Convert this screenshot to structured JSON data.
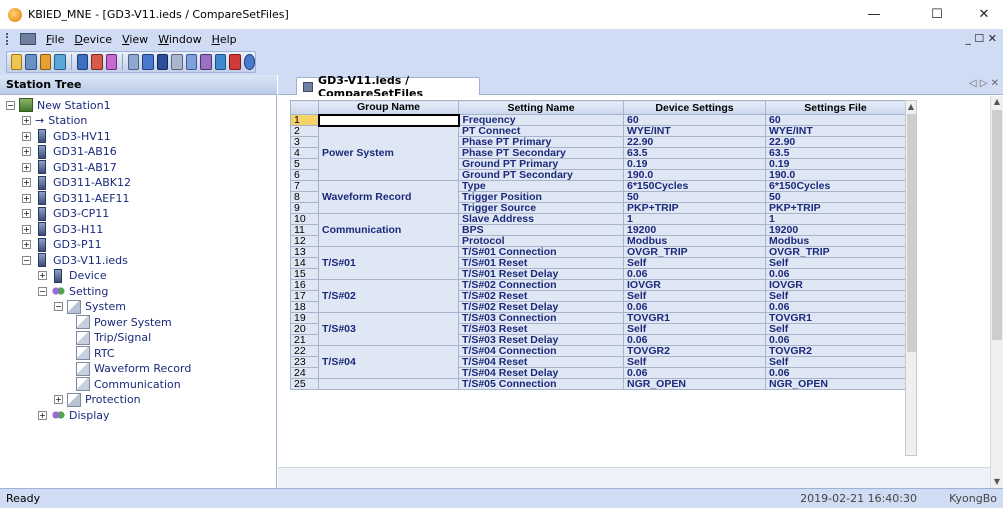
{
  "window": {
    "title": "KBIED_MNE - [GD3-V11.ieds / CompareSetFiles]",
    "minimize": "—",
    "maximize": "☐",
    "close": "✕",
    "mdi_controls": "_ ☐ ✕"
  },
  "menu": {
    "items": [
      "File",
      "Device",
      "View",
      "Window",
      "Help"
    ]
  },
  "toolbar": {
    "icons": [
      "new-icon",
      "open-icon",
      "save-icon",
      "print-icon",
      "compare-icon",
      "upload-icon",
      "download-icon",
      "link-icon",
      "monitor-icon",
      "grid-icon",
      "window-icon",
      "wave-icon",
      "wave2-icon",
      "export-icon",
      "close-icon",
      "help-icon"
    ]
  },
  "left_pane": {
    "title": "Station Tree",
    "tree": [
      {
        "label": "New Station1",
        "level": 0,
        "icon": "station-icon",
        "expander": "−"
      },
      {
        "label": "Station",
        "level": 1,
        "icon": "arrow",
        "expander": "+"
      },
      {
        "label": "GD3-HV11",
        "level": 1,
        "icon": "ied-icon",
        "expander": "+"
      },
      {
        "label": "GD31-AB16",
        "level": 1,
        "icon": "ied-icon",
        "expander": "+"
      },
      {
        "label": "GD31-AB17",
        "level": 1,
        "icon": "ied-icon",
        "expander": "+"
      },
      {
        "label": "GD311-ABK12",
        "level": 1,
        "icon": "ied-icon",
        "expander": "+"
      },
      {
        "label": "GD311-AEF11",
        "level": 1,
        "icon": "ied-icon",
        "expander": "+"
      },
      {
        "label": "GD3-CP11",
        "level": 1,
        "icon": "ied-icon",
        "expander": "+"
      },
      {
        "label": "GD3-H11",
        "level": 1,
        "icon": "ied-icon",
        "expander": "+"
      },
      {
        "label": "GD3-P11",
        "level": 1,
        "icon": "ied-icon",
        "expander": "+"
      },
      {
        "label": "GD3-V11.ieds",
        "level": 1,
        "icon": "ied-icon",
        "expander": "−"
      },
      {
        "label": "Device",
        "level": 2,
        "icon": "ied-icon",
        "expander": "+"
      },
      {
        "label": "Setting",
        "level": 2,
        "icon": "setting-icon",
        "expander": "−"
      },
      {
        "label": "System",
        "level": 3,
        "icon": "folder-icon",
        "expander": "−"
      },
      {
        "label": "Power System",
        "level": 4,
        "icon": "leaf-icon",
        "expander": ""
      },
      {
        "label": "Trip/Signal",
        "level": 4,
        "icon": "leaf-icon",
        "expander": ""
      },
      {
        "label": "RTC",
        "level": 4,
        "icon": "leaf-icon",
        "expander": ""
      },
      {
        "label": "Waveform Record",
        "level": 4,
        "icon": "leaf-icon",
        "expander": ""
      },
      {
        "label": "Communication",
        "level": 4,
        "icon": "leaf-icon",
        "expander": ""
      },
      {
        "label": "Protection",
        "level": 3,
        "icon": "folder-icon",
        "expander": "+"
      },
      {
        "label": "Display",
        "level": 2,
        "icon": "setting-icon",
        "expander": "+"
      }
    ]
  },
  "right_pane": {
    "tab": "GD3-V11.ieds / CompareSetFiles",
    "tab_nav": "◁ ▷ ✕"
  },
  "table": {
    "headers": {
      "group": "Group Name",
      "setting": "Setting Name",
      "device": "Device Settings",
      "file": "Settings File"
    },
    "groups": [
      {
        "name": "",
        "rows": [
          1
        ]
      },
      {
        "name": "Power System",
        "rows": [
          2,
          3,
          4,
          5,
          6
        ]
      },
      {
        "name": "Waveform Record",
        "rows": [
          7,
          8,
          9
        ]
      },
      {
        "name": "Communication",
        "rows": [
          10,
          11,
          12
        ]
      },
      {
        "name": "T/S#01",
        "rows": [
          13,
          14,
          15
        ]
      },
      {
        "name": "T/S#02",
        "rows": [
          16,
          17,
          18
        ]
      },
      {
        "name": "T/S#03",
        "rows": [
          19,
          20,
          21
        ]
      },
      {
        "name": "T/S#04",
        "rows": [
          22,
          23,
          24
        ]
      },
      {
        "name": "",
        "rows": [
          25
        ]
      }
    ],
    "rows": [
      {
        "n": "1",
        "setting": "Frequency",
        "device": "60",
        "file": "60"
      },
      {
        "n": "2",
        "setting": "PT Connect",
        "device": "WYE/INT",
        "file": "WYE/INT"
      },
      {
        "n": "3",
        "setting": "Phase PT Primary",
        "device": "22.90",
        "file": "22.90"
      },
      {
        "n": "4",
        "setting": "Phase PT Secondary",
        "device": "63.5",
        "file": "63.5"
      },
      {
        "n": "5",
        "setting": "Ground PT Primary",
        "device": "0.19",
        "file": "0.19"
      },
      {
        "n": "6",
        "setting": "Ground PT Secondary",
        "device": "190.0",
        "file": "190.0"
      },
      {
        "n": "7",
        "setting": "Type",
        "device": "6*150Cycles",
        "file": "6*150Cycles"
      },
      {
        "n": "8",
        "setting": "Trigger Position",
        "device": "50",
        "file": "50"
      },
      {
        "n": "9",
        "setting": "Trigger Source",
        "device": "PKP+TRIP",
        "file": "PKP+TRIP"
      },
      {
        "n": "10",
        "setting": "Slave Address",
        "device": "1",
        "file": "1"
      },
      {
        "n": "11",
        "setting": "BPS",
        "device": "19200",
        "file": "19200"
      },
      {
        "n": "12",
        "setting": "Protocol",
        "device": "Modbus",
        "file": "Modbus"
      },
      {
        "n": "13",
        "setting": "T/S#01 Connection",
        "device": "OVGR_TRIP",
        "file": "OVGR_TRIP"
      },
      {
        "n": "14",
        "setting": "T/S#01 Reset",
        "device": "Self",
        "file": "Self"
      },
      {
        "n": "15",
        "setting": "T/S#01 Reset Delay",
        "device": "0.06",
        "file": "0.06"
      },
      {
        "n": "16",
        "setting": "T/S#02 Connection",
        "device": "IOVGR",
        "file": "IOVGR"
      },
      {
        "n": "17",
        "setting": "T/S#02 Reset",
        "device": "Self",
        "file": "Self"
      },
      {
        "n": "18",
        "setting": "T/S#02 Reset Delay",
        "device": "0.06",
        "file": "0.06"
      },
      {
        "n": "19",
        "setting": "T/S#03 Connection",
        "device": "TOVGR1",
        "file": "TOVGR1"
      },
      {
        "n": "20",
        "setting": "T/S#03 Reset",
        "device": "Self",
        "file": "Self"
      },
      {
        "n": "21",
        "setting": "T/S#03 Reset Delay",
        "device": "0.06",
        "file": "0.06"
      },
      {
        "n": "22",
        "setting": "T/S#04 Connection",
        "device": "TOVGR2",
        "file": "TOVGR2"
      },
      {
        "n": "23",
        "setting": "T/S#04 Reset",
        "device": "Self",
        "file": "Self"
      },
      {
        "n": "24",
        "setting": "T/S#04 Reset Delay",
        "device": "0.06",
        "file": "0.06"
      },
      {
        "n": "25",
        "setting": "T/S#05 Connection",
        "device": "NGR_OPEN",
        "file": "NGR_OPEN"
      }
    ]
  },
  "status": {
    "left": "Ready",
    "datetime": "2019-02-21 16:40:30",
    "user": "KyongBo"
  },
  "colors": {
    "chrome": "#cfdcf3",
    "cell": "#dfe6f4",
    "cell_text": "#1b2a7a",
    "selected_row": "#f6d36a"
  }
}
